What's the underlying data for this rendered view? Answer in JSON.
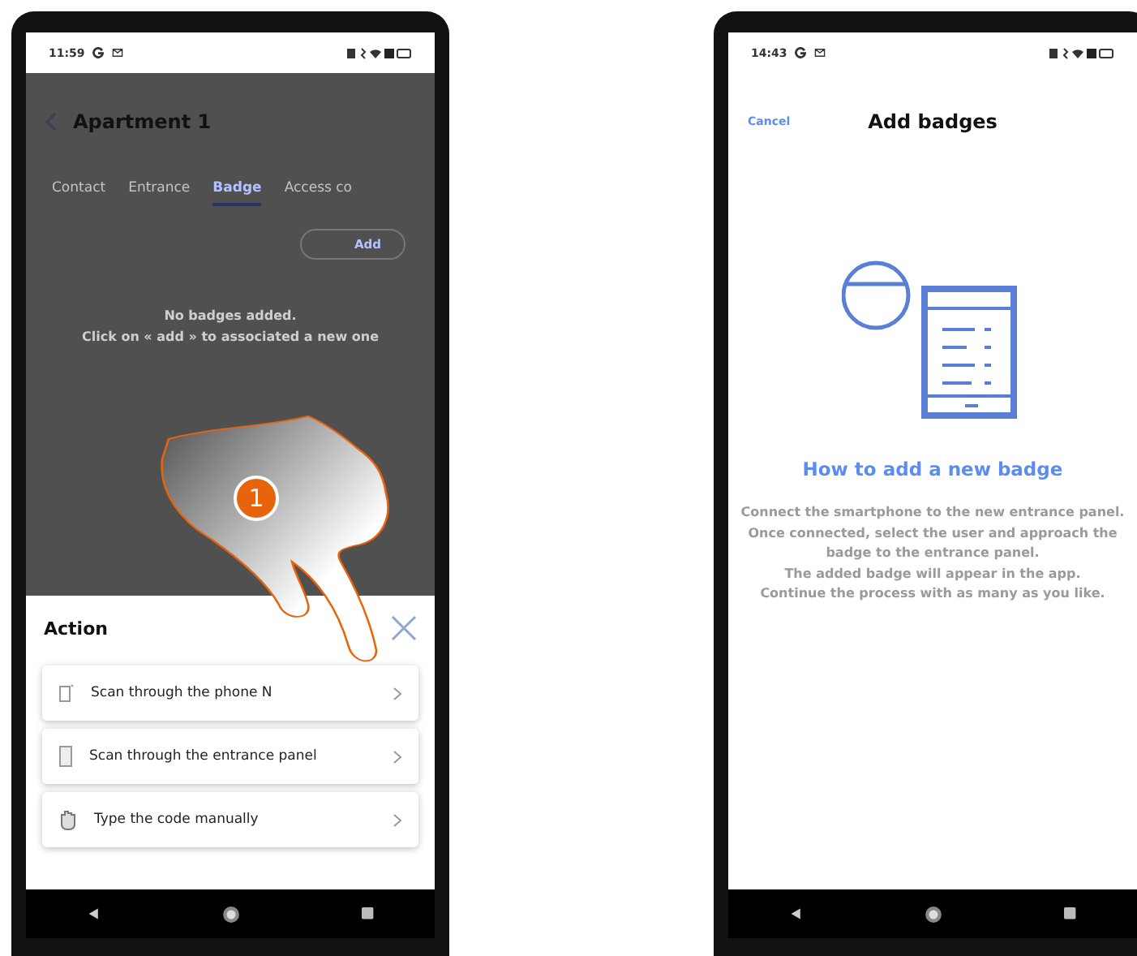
{
  "left_phone": {
    "status_bar": {
      "time": "11:59"
    },
    "header": {
      "title": "Apartment 1"
    },
    "tabs": [
      {
        "label": "Contact",
        "selected": false
      },
      {
        "label": "Entrance",
        "selected": false
      },
      {
        "label": "Badge",
        "selected": true
      },
      {
        "label": "Access co",
        "selected": false
      }
    ],
    "add_button": "Add",
    "empty_message": [
      "No badges added.",
      "Click on « add » to associated a new one"
    ],
    "sheet": {
      "title": "Action",
      "items": [
        {
          "kind": "phone",
          "label": "Scan through the phone N"
        },
        {
          "kind": "panel",
          "label": "Scan through the entrance panel"
        },
        {
          "kind": "hand",
          "label": "Type the code manually"
        }
      ]
    },
    "step_marker": "1"
  },
  "right_phone": {
    "status_bar": {
      "time": "14:43"
    },
    "header": {
      "cancel": "Cancel",
      "title": "Add badges"
    },
    "heading": "How to add a new badge",
    "instructions": [
      "Connect the smartphone to the new entrance panel.",
      "Once connected, select the user and approach the badge to the entrance panel.",
      "The added badge will appear in the app.",
      "Continue the process with as many as you like."
    ]
  }
}
